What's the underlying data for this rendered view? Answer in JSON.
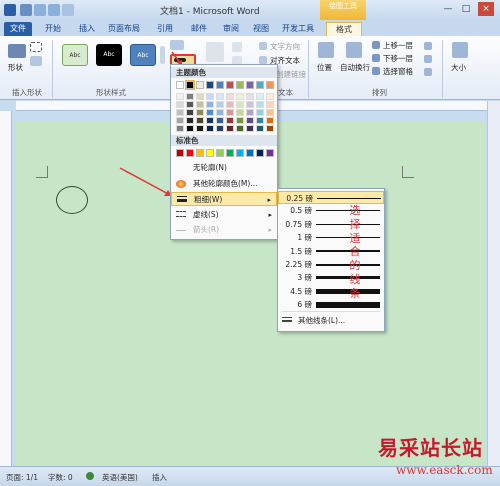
{
  "window": {
    "title": "文档1 - Microsoft Word",
    "context_tab_header": "绘图工具",
    "controls": [
      "—",
      "□",
      "×"
    ]
  },
  "tabs": [
    "文件",
    "开始",
    "插入",
    "页面布局",
    "引用",
    "邮件",
    "审阅",
    "视图",
    "开发工具",
    "格式"
  ],
  "ribbon": {
    "insert_shape_label": "形状",
    "insert_shape_group": "插入形状",
    "shape_styles_group": "形状样式",
    "style_samples": [
      "Abc",
      "Abc",
      "Abc"
    ],
    "text_direction": "文字方向",
    "align_text": "对齐文本",
    "create_link": "创建链接",
    "text_group": "文本",
    "position": "位置",
    "wrap_text": "自动换行",
    "bring_forward": "上移一层",
    "send_backward": "下移一层",
    "selection_pane": "选择窗格",
    "arrange_group": "排列",
    "size_label": "大小"
  },
  "color_menu": {
    "theme_header": "主题颜色",
    "standard_header": "标准色",
    "no_outline": "无轮廓(N)",
    "more_colors": "其他轮廓颜色(M)...",
    "weight": "粗细(W)",
    "dashes": "虚线(S)",
    "arrows": "箭头(R)",
    "theme_row1": [
      "#ffffff",
      "#000000",
      "#eeece1",
      "#1f497d",
      "#4f81bd",
      "#c0504d",
      "#9bbb59",
      "#8064a2",
      "#4bacc6",
      "#f79646"
    ],
    "theme_tint_columns": [
      [
        "#f2f2f2",
        "#d9d9d9",
        "#bfbfbf",
        "#a6a6a6",
        "#808080"
      ],
      [
        "#808080",
        "#595959",
        "#404040",
        "#262626",
        "#0d0d0d"
      ],
      [
        "#ddd9c3",
        "#c4bd97",
        "#948a54",
        "#4a452a",
        "#1e1c11"
      ],
      [
        "#c6d9f1",
        "#8eb4e3",
        "#548dd4",
        "#17365d",
        "#0f243e"
      ],
      [
        "#dbe5f1",
        "#b8cce4",
        "#95b3d7",
        "#366092",
        "#244061"
      ],
      [
        "#f2dcdb",
        "#e6b9b8",
        "#d99694",
        "#953735",
        "#632523"
      ],
      [
        "#ebf1dd",
        "#d7e4bd",
        "#c3d69b",
        "#77933c",
        "#4f6228"
      ],
      [
        "#e5e0ec",
        "#ccc1da",
        "#b3a2c7",
        "#604a7b",
        "#3f3151"
      ],
      [
        "#dbeef4",
        "#b7dde8",
        "#93cddd",
        "#31859c",
        "#215968"
      ],
      [
        "#fdeada",
        "#fbd5b5",
        "#fac090",
        "#e46c0a",
        "#984807"
      ]
    ],
    "standard_colors": [
      "#c00000",
      "#ff0000",
      "#ffc000",
      "#ffff00",
      "#92d050",
      "#00b050",
      "#00b0f0",
      "#0070c0",
      "#002060",
      "#7030a0"
    ]
  },
  "weight_menu": {
    "weights": [
      {
        "label": "0.25 磅",
        "pt": 0.25
      },
      {
        "label": "0.5 磅",
        "pt": 0.5
      },
      {
        "label": "0.75 磅",
        "pt": 0.75
      },
      {
        "label": "1 磅",
        "pt": 1
      },
      {
        "label": "1.5 磅",
        "pt": 1.5
      },
      {
        "label": "2.25 磅",
        "pt": 2.25
      },
      {
        "label": "3 磅",
        "pt": 3
      },
      {
        "label": "4.5 磅",
        "pt": 4.5
      },
      {
        "label": "6 磅",
        "pt": 6
      }
    ],
    "more_lines": "其他线条(L)...",
    "annotation": "选择适合的线条"
  },
  "status": {
    "page": "页面: 1/1",
    "words": "字数: 0",
    "language": "英语(美国)",
    "mode": "插入"
  },
  "watermark": {
    "main": "易采站长站",
    "url": "www.easck.com"
  },
  "colors": {
    "accent": "#f0b838",
    "highlight": "#fde9a8",
    "page": "#c7e6c8",
    "arrow": "#e03838"
  }
}
